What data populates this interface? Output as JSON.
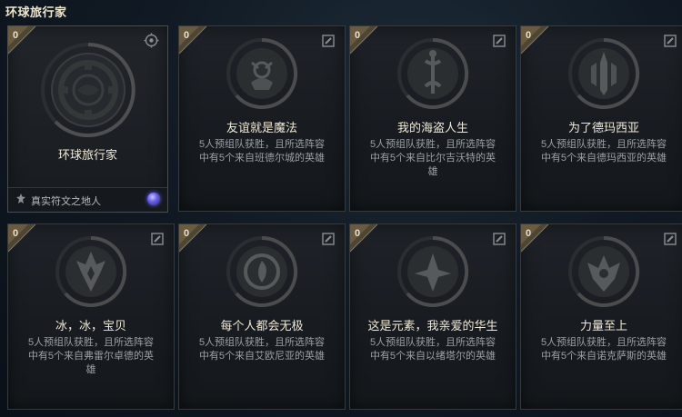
{
  "page": {
    "title": "环球旅行家"
  },
  "featured": {
    "count": "0",
    "title": "环球旅行家",
    "footer_label": "真实符文之地人",
    "icons": {
      "target": "crosshair-icon",
      "footer": "legend-statue-icon",
      "orb": "blue-orb-icon"
    }
  },
  "cards": [
    {
      "count": "0",
      "title": "友谊就是魔法",
      "desc_line1": "5人预组队获胜，且所选阵容",
      "desc_line2": "中有5个来自班德尔城的英雄",
      "emblem": "bandle-city-emblem-icon"
    },
    {
      "count": "0",
      "title": "我的海盗人生",
      "desc_line1": "5人预组队获胜，且所选阵容",
      "desc_line2": "中有5个来自比尔吉沃特的英",
      "desc_line3": "雄",
      "emblem": "bilgewater-emblem-icon"
    },
    {
      "count": "0",
      "title": "为了德玛西亚",
      "desc_line1": "5人预组队获胜，且所选阵容",
      "desc_line2": "中有5个来自德玛西亚的英雄",
      "emblem": "demacia-emblem-icon"
    },
    {
      "count": "0",
      "title": "冰，冰，宝贝",
      "desc_line1": "5人预组队获胜，且所选阵容",
      "desc_line2": "中有5个来自弗雷尔卓德的英",
      "desc_line3": "雄",
      "emblem": "freljord-emblem-icon"
    },
    {
      "count": "0",
      "title": "每个人都会无极",
      "desc_line1": "5人预组队获胜，且所选阵容",
      "desc_line2": "中有5个来自艾欧尼亚的英雄",
      "emblem": "ionia-emblem-icon"
    },
    {
      "count": "0",
      "title": "这是元素，我亲爱的华生",
      "desc_line1": "5人预组队获胜，且所选阵容",
      "desc_line2": "中有5个来自以绪塔尔的英雄",
      "emblem": "ixtal-emblem-icon"
    },
    {
      "count": "0",
      "title": "力量至上",
      "desc_line1": "5人预组队获胜，且所选阵容",
      "desc_line2": "中有5个来自诺克萨斯的英雄",
      "emblem": "noxus-emblem-icon"
    }
  ],
  "colors": {
    "background": "#111a24",
    "card": "#1b1f24",
    "corner_bronze": "#6a5a3f",
    "title_text": "#f0e8d6",
    "desc_text": "#9ba0a4",
    "orb_blue": "#6c62e8"
  }
}
